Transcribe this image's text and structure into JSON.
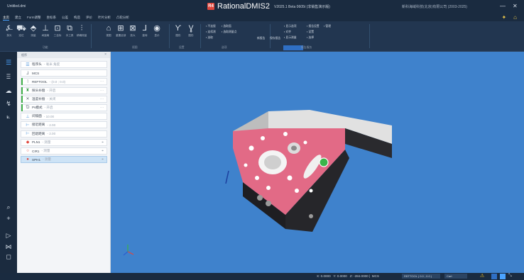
{
  "window": {
    "doc_title": "Untitled.dmi",
    "app_name": "RationalDMIS2",
    "version": "V2025.1 Beta 0605t (非销售演示版)",
    "company": "新科海域科技(北京)有限公司 (2003-2025)",
    "logo_text": "R4",
    "min_btn": "—",
    "close_btn": "✕"
  },
  "menu": {
    "items": [
      "主页",
      "建立",
      "Form调整",
      "坐标系",
      "公差",
      "构造",
      "评价",
      "叶片分析",
      "凸轮分析"
    ],
    "active_index": 0
  },
  "ribbon": {
    "tools_func": [
      {
        "label": "探头",
        "icon": "probe-icon",
        "glyph": "⍼"
      },
      {
        "label": "定位",
        "icon": "locate-icon",
        "glyph": "⛟"
      },
      {
        "label": "测量",
        "icon": "measure-icon",
        "glyph": "⬘"
      },
      {
        "label": "间距离",
        "icon": "distance-icon",
        "glyph": "⊥"
      },
      {
        "label": "三坐标",
        "icon": "cmm-icon",
        "glyph": "⊡"
      },
      {
        "label": "手工具",
        "icon": "hand-tool-icon",
        "glyph": "⧉"
      },
      {
        "label": "精确测量",
        "icon": "precise-icon",
        "glyph": "⫶"
      }
    ],
    "tools_view": [
      {
        "label": "视图",
        "icon": "home-view-icon",
        "glyph": "⌂"
      },
      {
        "label": "重置全部",
        "icon": "reset-view-icon",
        "glyph": "⊞"
      },
      {
        "label": "放大",
        "icon": "zoom-icon",
        "glyph": "⊠"
      },
      {
        "label": "旋转",
        "icon": "rotate-icon",
        "glyph": "⅃"
      },
      {
        "label": "显示",
        "icon": "eye-icon",
        "glyph": "◉"
      }
    ],
    "tools_settings": [
      {
        "label": "图形",
        "icon": "graphics-icon",
        "glyph": "Ƴ"
      },
      {
        "label": "图形",
        "icon": "graphics2-icon",
        "glyph": "Ɣ"
      }
    ],
    "small_options": [
      "不连接",
      "连续测",
      "选取",
      "选取面",
      "选取测量点"
    ],
    "small_doc": [
      "新报告",
      "保存报告"
    ],
    "small_report": [
      "显示选项",
      "对齐",
      "显示测量",
      "报告设置",
      "设置",
      "选择",
      "管理"
    ],
    "group_labels": [
      "功能",
      "视图",
      "设置",
      "选项",
      "报告服务"
    ],
    "highlight_label": "显示选项"
  },
  "iconbar": {
    "items": [
      {
        "icon": "program-list-icon",
        "glyph": "☰"
      },
      {
        "icon": "tree-icon",
        "glyph": "Ⲷ"
      },
      {
        "icon": "cloud-icon",
        "glyph": "☁"
      },
      {
        "icon": "curve-icon",
        "glyph": "↯"
      },
      {
        "icon": "chart-icon",
        "glyph": "⟀"
      },
      {
        "icon": "search-icon",
        "glyph": "⌕"
      },
      {
        "icon": "add-icon",
        "glyph": "+"
      },
      {
        "icon": "play-icon",
        "glyph": "▷"
      },
      {
        "icon": "step-icon",
        "glyph": "⋈"
      },
      {
        "icon": "stop-icon",
        "glyph": "◻"
      }
    ]
  },
  "panel": {
    "title": "程序",
    "close": "×",
    "rows": [
      {
        "label": "程序头",
        "sub": "毫米 角度",
        "icon": "header-icon",
        "glyph": "☰",
        "color": "#4a90d9",
        "bar": ""
      },
      {
        "label": "MCS",
        "sub": "",
        "icon": "mcs-icon",
        "glyph": "⅃",
        "color": "#5b6675",
        "bar": ""
      },
      {
        "label": "REFTOOL",
        "sub": "(0.0 ; 0.0)",
        "icon": "probe-icon",
        "glyph": "⊺",
        "color": "#5b6675",
        "bar": "#42b04a",
        "more": "···"
      },
      {
        "label": "探头补偿",
        "sub": "开启",
        "icon": "probe-comp-icon",
        "glyph": "♜",
        "color": "#3a9c4a",
        "bar": "#42b04a",
        "more": "···"
      },
      {
        "label": "温度补偿",
        "sub": "关闭",
        "icon": "temperature-icon",
        "glyph": "✕",
        "color": "#5b6675",
        "bar": "#42b04a",
        "more": "···"
      },
      {
        "label": "Ps模式",
        "sub": "开启",
        "icon": "ps-mode-icon",
        "glyph": "Ɗ",
        "color": "#5b6675",
        "bar": "#42b04a",
        "more": "···"
      },
      {
        "label": "间隔面",
        "sub": "10.00",
        "icon": "clearance-icon",
        "glyph": "⊥",
        "color": "#4a90d9",
        "bar": ""
      },
      {
        "label": "接近距离",
        "sub": "2.00",
        "icon": "approach-icon",
        "glyph": "⊢",
        "color": "#4a90d9",
        "bar": ""
      },
      {
        "label": "回退距离",
        "sub": "2.00",
        "icon": "retract-icon",
        "glyph": "⊢",
        "color": "#4a90d9",
        "bar": ""
      },
      {
        "label": "PLN1",
        "sub": "测量",
        "icon": "plane-icon",
        "glyph": "◆",
        "color": "#e0463c",
        "bar": "",
        "more": "⌖"
      },
      {
        "label": "CIR1",
        "sub": "测量",
        "icon": "circle-icon",
        "glyph": "○",
        "color": "#e0463c",
        "bar": "",
        "more": "⌖"
      },
      {
        "label": "SPH1",
        "sub": "测量",
        "icon": "sphere-icon",
        "glyph": "●",
        "color": "#e0463c",
        "bar": "",
        "more": "⌖",
        "selected": true
      }
    ]
  },
  "status": {
    "x_label": "X: 0.0000",
    "y_label": "Y: 0.0000",
    "z_label": "Z: -284.0000",
    "cs": "MCS",
    "probe": "REFTOOL ( 0.0 ; 0.0 )",
    "mode": "Cart",
    "warn_icon": "warning-icon"
  },
  "colors": {
    "viewport_bg": "#3f82cc",
    "part_top": "#e26a86",
    "part_side": "#1e1e22",
    "part_bracket": "#d9d9d9",
    "accent": "#4aa3ff"
  }
}
